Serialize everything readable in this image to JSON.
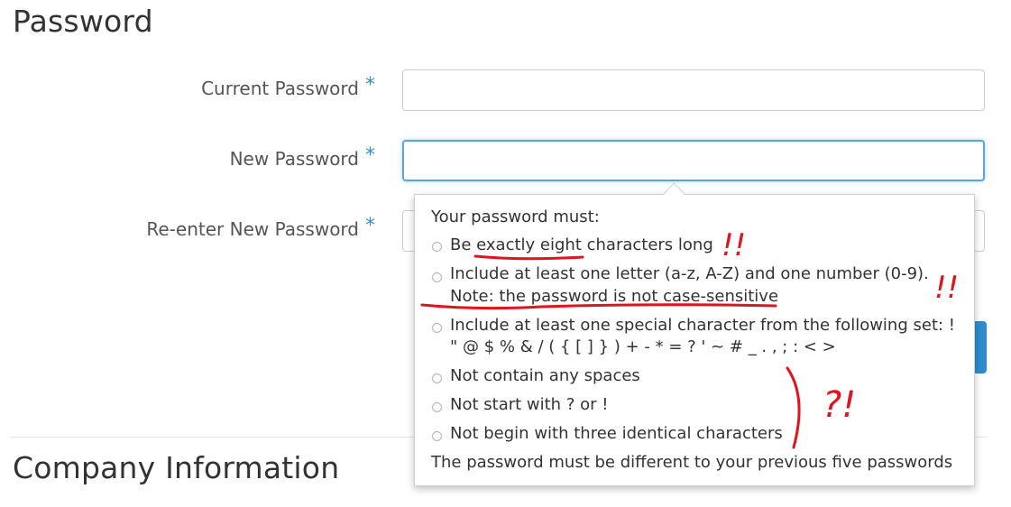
{
  "sections": {
    "password_title": "Password",
    "company_title": "Company Information"
  },
  "form": {
    "required_mark": "*",
    "current_password_label": "Current Password",
    "new_password_label": "New Password",
    "reenter_password_label": "Re-enter New Password",
    "current_password_value": "",
    "new_password_value": "",
    "reenter_password_value": ""
  },
  "popover": {
    "intro": "Your password must:",
    "rules": [
      {
        "line1": "Be exactly eight characters long",
        "line2": ""
      },
      {
        "line1": "Include at least one letter (a-z, A-Z) and one number (0-9).",
        "line2": "Note: the password is not case-sensitive"
      },
      {
        "line1": "Include at least one special character from the following set: !",
        "line2": "\" @ $ % & / ( { [ ] } ) + - * = ? ' ~ # _ . , ; : < >"
      },
      {
        "line1": "Not contain any spaces",
        "line2": ""
      },
      {
        "line1": "Not start with ? or !",
        "line2": ""
      },
      {
        "line1": "Not begin with three identical characters",
        "line2": ""
      }
    ],
    "footer": "The password must be different to your previous five passwords"
  },
  "annotations": {
    "marks": [
      "!!",
      "!!",
      "?!"
    ],
    "color": "#e0141e"
  },
  "colors": {
    "accent": "#2e8ccf",
    "required_star": "#3b8fc5",
    "focus_border": "#5aa7d8"
  }
}
